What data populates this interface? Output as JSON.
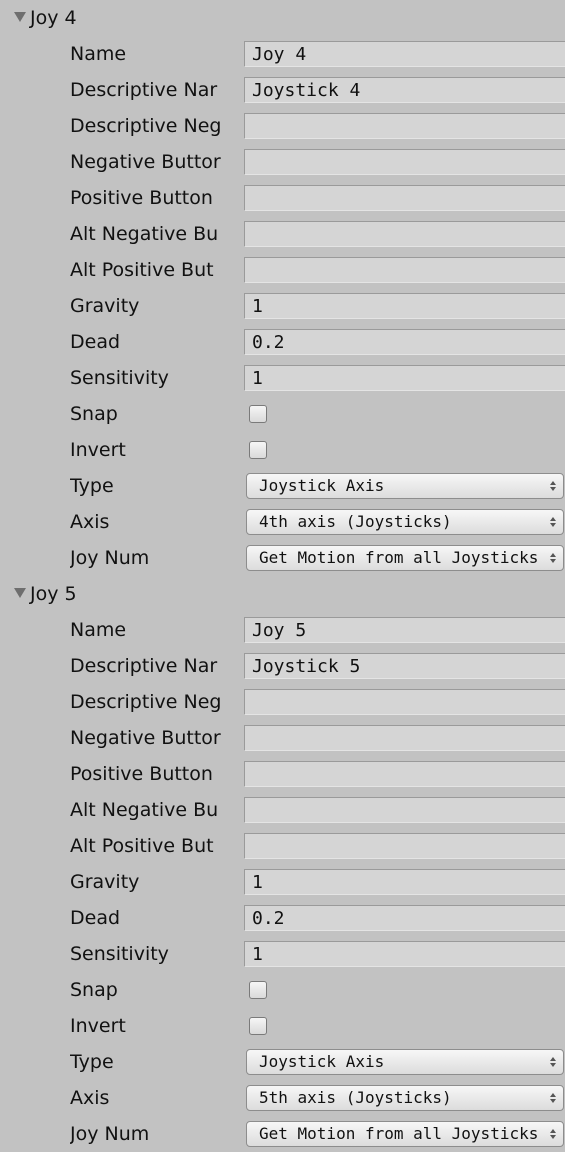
{
  "groups": [
    {
      "title": "Joy 4",
      "labels": {
        "name": "Name",
        "descriptive_name": "Descriptive Nar",
        "descriptive_negative": "Descriptive Neg",
        "negative_button": "Negative Buttor",
        "positive_button": "Positive Button",
        "alt_negative": "Alt Negative Bu",
        "alt_positive": "Alt Positive But",
        "gravity": "Gravity",
        "dead": "Dead",
        "sensitivity": "Sensitivity",
        "snap": "Snap",
        "invert": "Invert",
        "type": "Type",
        "axis": "Axis",
        "joy_num": "Joy Num"
      },
      "values": {
        "name": "Joy 4",
        "descriptive_name": "Joystick 4",
        "descriptive_negative": "",
        "negative_button": "",
        "positive_button": "",
        "alt_negative": "",
        "alt_positive": "",
        "gravity": "1",
        "dead": "0.2",
        "sensitivity": "1",
        "snap": false,
        "invert": false,
        "type": "Joystick Axis",
        "axis": "4th axis (Joysticks)",
        "joy_num": "Get Motion from all Joysticks"
      }
    },
    {
      "title": "Joy 5",
      "labels": {
        "name": "Name",
        "descriptive_name": "Descriptive Nar",
        "descriptive_negative": "Descriptive Neg",
        "negative_button": "Negative Buttor",
        "positive_button": "Positive Button",
        "alt_negative": "Alt Negative Bu",
        "alt_positive": "Alt Positive But",
        "gravity": "Gravity",
        "dead": "Dead",
        "sensitivity": "Sensitivity",
        "snap": "Snap",
        "invert": "Invert",
        "type": "Type",
        "axis": "Axis",
        "joy_num": "Joy Num"
      },
      "values": {
        "name": "Joy 5",
        "descriptive_name": "Joystick 5",
        "descriptive_negative": "",
        "negative_button": "",
        "positive_button": "",
        "alt_negative": "",
        "alt_positive": "",
        "gravity": "1",
        "dead": "0.2",
        "sensitivity": "1",
        "snap": false,
        "invert": false,
        "type": "Joystick Axis",
        "axis": "5th axis (Joysticks)",
        "joy_num": "Get Motion from all Joysticks"
      }
    }
  ],
  "icons": {
    "foldout": "triangle-down-icon",
    "dropdown": "up-down-arrows-icon"
  },
  "colors": {
    "panel_background": "#c2c2c2",
    "field_background": "#d5d5d5"
  }
}
